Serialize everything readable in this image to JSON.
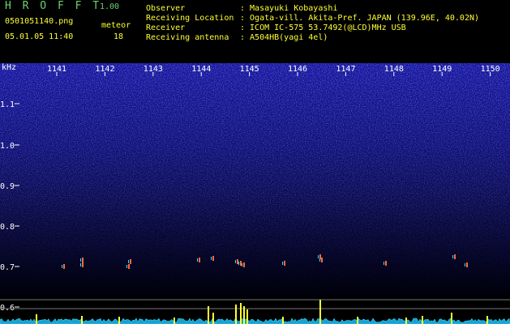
{
  "header": {
    "app_name": "H R O F F T",
    "version": "1.00",
    "filename": "0501051140.png",
    "datetime": "05.01.05 11:40",
    "meteor_label": "meteor",
    "meteor_count": "18",
    "observer_label": "Observer",
    "observer_value": ": Masayuki Kobayashi",
    "location_label": "Receiving Location",
    "location_value": ": Ogata-vill. Akita-Pref. JAPAN (139.96E, 40.02N)",
    "receiver_label": "Receiver",
    "receiver_value": ": ICOM IC-575 53.7492(@LCD)MHz USB",
    "antenna_label": "Receiving antenna",
    "antenna_value": ": A504HB(yagi 4el)"
  },
  "axis": {
    "y_unit": "kHz",
    "y_ticks": [
      "1.1",
      "1.0",
      "0.9",
      "0.8",
      "0.7",
      "0.6"
    ],
    "x_ticks": [
      "1141",
      "1142",
      "1143",
      "1144",
      "1145",
      "1146",
      "1147",
      "1148",
      "1149",
      "1150"
    ]
  },
  "colors": {
    "background": "#000000",
    "noise_dense": "#1a1aa0",
    "signal_yellow": "#ffff33",
    "spectrum_cyan": "#33e0ff",
    "header_green": "#6fd06f"
  }
}
